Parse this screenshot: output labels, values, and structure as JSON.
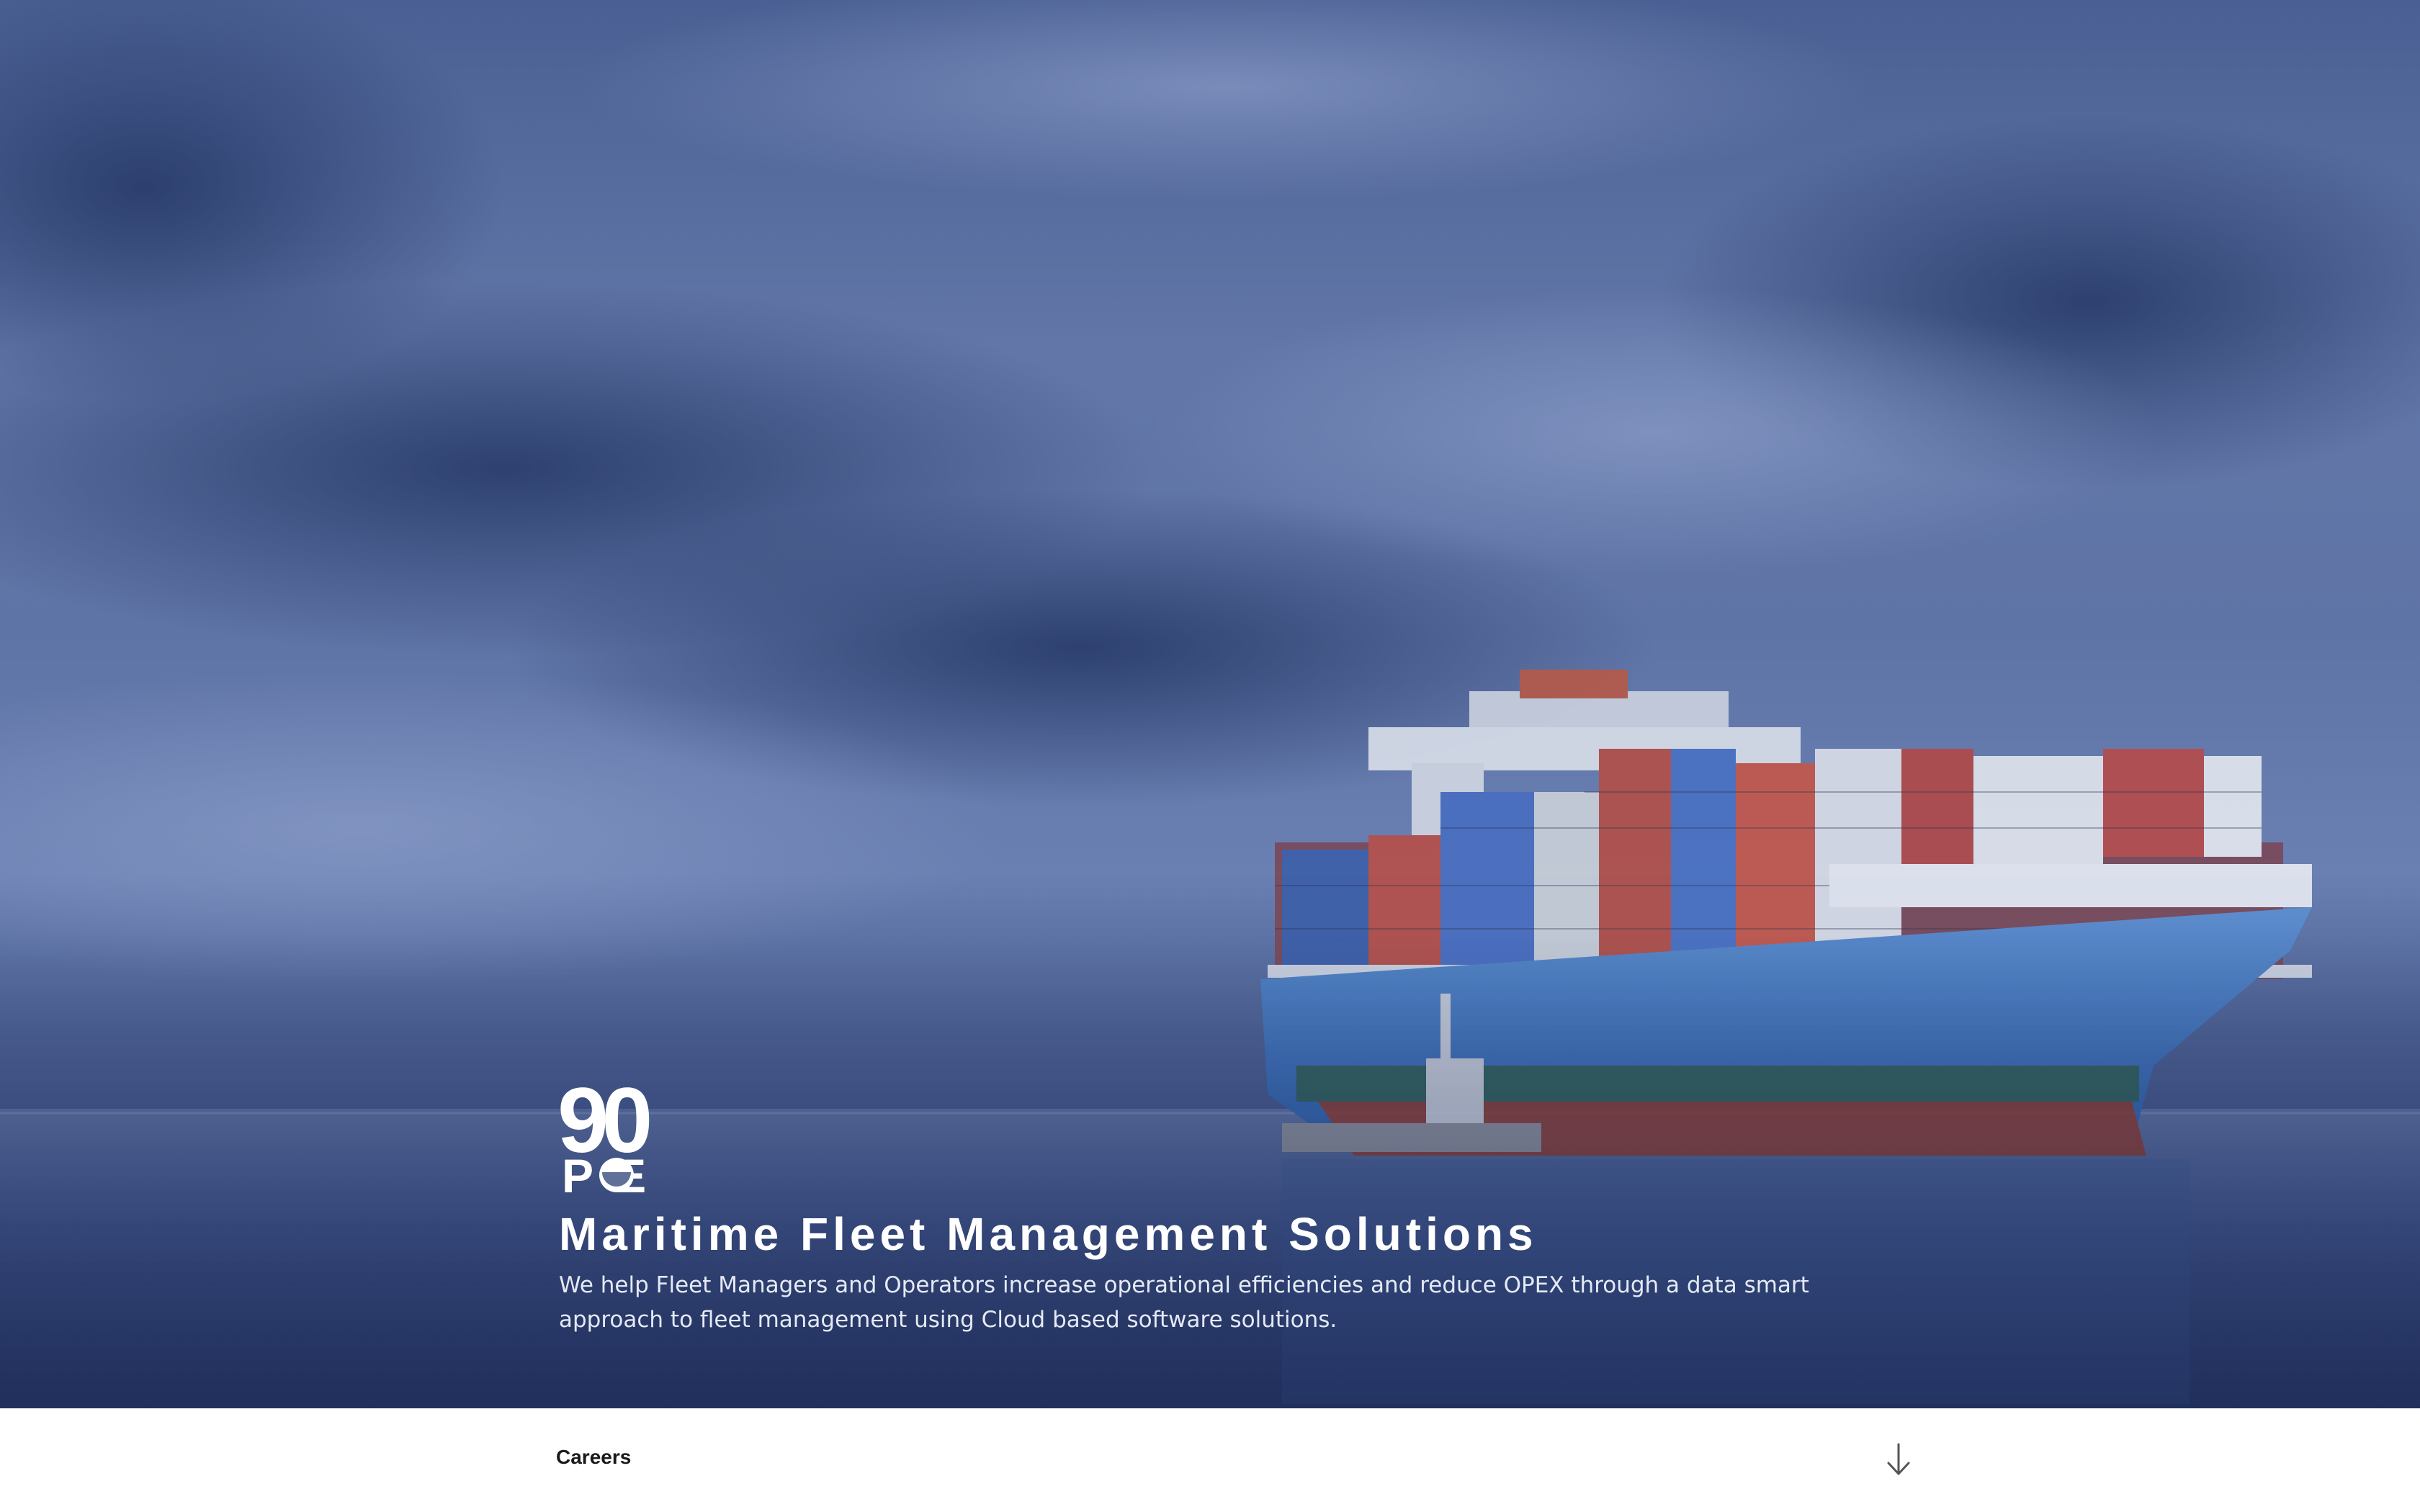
{
  "hero": {
    "logo": {
      "text_top": "90",
      "text_bottom": "POE"
    },
    "headline": "Maritime Fleet Management Solutions",
    "subtext": "We help Fleet Managers and Operators increase operational efficiencies and reduce OPEX through a data smart approach to fleet management using Cloud based software solutions.",
    "image": "container-ship-at-sea",
    "colors": {
      "overlay": "#34477a",
      "text": "#ffffff"
    }
  },
  "footer": {
    "careers_label": "Careers",
    "scroll_icon": "arrow-down-icon"
  }
}
